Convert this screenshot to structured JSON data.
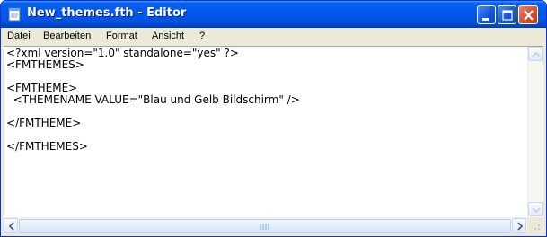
{
  "window": {
    "title": "New_themes.fth - Editor",
    "icon": "notepad-icon",
    "controls": [
      "minimize-icon",
      "maximize-icon",
      "close-icon"
    ]
  },
  "menu": {
    "items": [
      {
        "label": "Datei",
        "accesskey": "D"
      },
      {
        "label": "Bearbeiten",
        "accesskey": "B"
      },
      {
        "label": "Format",
        "accesskey": "o"
      },
      {
        "label": "Ansicht",
        "accesskey": "A"
      },
      {
        "label": "?",
        "accesskey": "?"
      }
    ]
  },
  "editor": {
    "lines": [
      "<?xml version=\"1.0\" standalone=\"yes\" ?>",
      "<FMTHEMES>",
      "",
      "<FMTHEME>",
      "  <THEMENAME VALUE=\"Blau und Gelb Bildschirm\" />",
      "",
      "</FMTHEME>",
      "",
      "</FMTHEMES>"
    ]
  },
  "scrollbars": {
    "vertical": {
      "up": "arrow-up-icon",
      "down": "arrow-down-icon"
    },
    "horizontal": {
      "left": "arrow-left-icon",
      "right": "arrow-right-icon",
      "position": 0
    }
  },
  "colors": {
    "titlebar": "#0055e5",
    "close_button": "#d94e2b",
    "chrome": "#ece9d8",
    "text": "#000000"
  }
}
